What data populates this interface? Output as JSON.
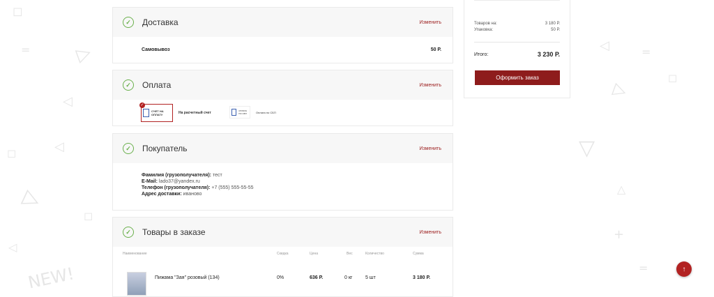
{
  "sections": {
    "delivery": {
      "title": "Доставка",
      "change": "Изменить",
      "method": "Самовывоз",
      "price": "50 Р."
    },
    "payment": {
      "title": "Оплата",
      "change": "Изменить",
      "options": [
        {
          "icon_text": "СЧЕТ НА ОПЛАТУ",
          "label": "На расчетный счет",
          "selected": true
        },
        {
          "icon_text": "ОПЛАТА ПО СБП",
          "label": "Оплата по СБП",
          "selected": false
        }
      ]
    },
    "buyer": {
      "title": "Покупатель",
      "change": "Изменить",
      "fields": [
        {
          "label": "Фамилия (грузополучателя):",
          "value": "тест"
        },
        {
          "label": "E-Mail:",
          "value": "lado37@yandex.ru"
        },
        {
          "label": "Телефон (грузополучателя):",
          "value": "+7 (555) 555-55-55"
        },
        {
          "label": "Адрес доставки:",
          "value": "иваново"
        }
      ]
    },
    "items": {
      "title": "Товары в заказе",
      "change": "Изменить",
      "headers": {
        "name": "Наименование",
        "discount": "Скидка",
        "price": "Цена",
        "weight": "Вес",
        "qty": "Количество",
        "sum": "Сумма"
      },
      "rows": [
        {
          "name": "Пижама \"Зая\" розовый (134)",
          "discount": "0%",
          "price": "636 Р.",
          "weight": "0 кг",
          "qty": "5 шт",
          "sum": "3 180 Р."
        }
      ]
    }
  },
  "summary": {
    "goods_label": "Товаров на:",
    "goods_value": "3 180 Р.",
    "pack_label": "Упаковка:",
    "pack_value": "50 Р.",
    "total_label": "Итого:",
    "total_value": "3 230 Р.",
    "checkout_label": "Оформить заказ"
  },
  "colors": {
    "accent": "#8e1c1c",
    "check": "#6ab04c"
  },
  "scroll_top_icon": "arrow-up-icon",
  "decor_text": "NEW!"
}
